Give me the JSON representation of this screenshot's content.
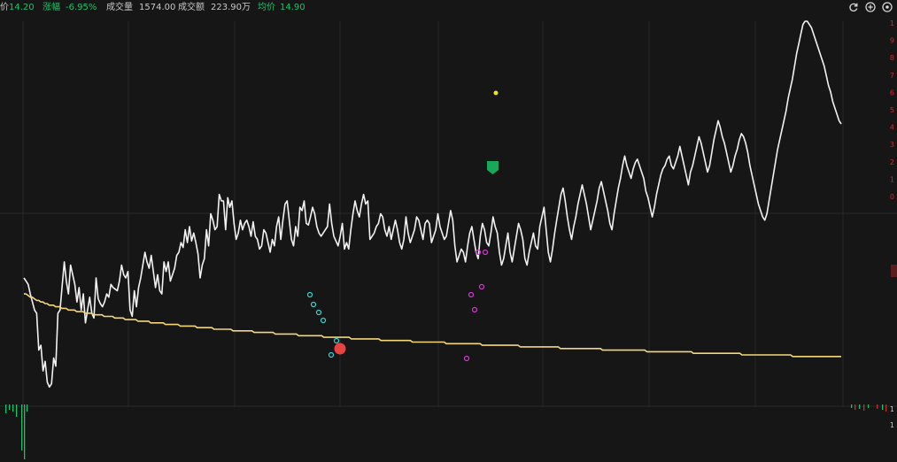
{
  "header": {
    "price_label": "价",
    "price_value": "14.20",
    "change_label": "涨幅",
    "change_value": "-6.95%",
    "volume_label": "成交量",
    "volume_value": "1574.00",
    "amount_label": "成交额",
    "amount_value": "223.90万",
    "avg_label": "均价",
    "avg_value": "14.90"
  },
  "toolbar": {
    "icons": [
      "refresh-icon",
      "zoom-in-icon",
      "settings-icon"
    ]
  },
  "colors": {
    "background": "#161616",
    "price_line": "#f2f2f2",
    "avg_line": "#f3d77a",
    "indicator_line": "#a450f0",
    "cyan_marker": "#39d4d4",
    "magenta_marker": "#d23ad2",
    "buy_badge": "#19a85a",
    "sell_badge": "#e84343",
    "down_text": "#1fc06a",
    "up_tick": "#c03030"
  },
  "right_axis": {
    "upper_ticks": [
      "1",
      "9",
      "8",
      "7",
      "6",
      "5",
      "4",
      "3",
      "2",
      "1",
      "0"
    ],
    "lower_ticks": [
      "1",
      "1"
    ]
  },
  "chart_data": {
    "type": "line",
    "series": [
      {
        "color": "#f2f2f2",
        "values": [
          80,
          78,
          76,
          70,
          65,
          60,
          58,
          35,
          38,
          22,
          28,
          15,
          12,
          14,
          30,
          25,
          58,
          60,
          75,
          90,
          78,
          70,
          88,
          82,
          76,
          65,
          74,
          60,
          70,
          52,
          60,
          68,
          58,
          55,
          80,
          67,
          64,
          62,
          65,
          70,
          68,
          76,
          74,
          73,
          72,
          78,
          88,
          82,
          80,
          84,
          60,
          56,
          72,
          62,
          74,
          80,
          88,
          96,
          90,
          86,
          94,
          84,
          74,
          82,
          72,
          70,
          90,
          84,
          90,
          78,
          82,
          86,
          94,
          96,
          102,
          99,
          110,
          102,
          112,
          103,
          108,
          102,
          95,
          80,
          88,
          92,
          110,
          100,
          120,
          116,
          110,
          112,
          132,
          128,
          128,
          110,
          130,
          124,
          128,
          114,
          104,
          108,
          116,
          110,
          114,
          116,
          112,
          106,
          115,
          106,
          104,
          98,
          100,
          110,
          108,
          102,
          96,
          104,
          100,
          112,
          118,
          104,
          116,
          126,
          128,
          116,
          104,
          100,
          112,
          106,
          124,
          122,
          128,
          114,
          113,
          118,
          124,
          120,
          112,
          108,
          106,
          108,
          110,
          112,
          126,
          114,
          106,
          103,
          100,
          106,
          114,
          98,
          102,
          98,
          110,
          120,
          128,
          122,
          118,
          126,
          132,
          126,
          128,
          104,
          106,
          108,
          112,
          114,
          120,
          118,
          110,
          106,
          112,
          104,
          110,
          116,
          110,
          102,
          98,
          104,
          118,
          108,
          102,
          106,
          110,
          118,
          116,
          110,
          104,
          114,
          116,
          114,
          102,
          106,
          110,
          120,
          112,
          108,
          104,
          106,
          114,
          122,
          116,
          100,
          90,
          94,
          98,
          96,
          90,
          100,
          108,
          112,
          104,
          96,
          92,
          106,
          114,
          110,
          102,
          100,
          108,
          118,
          112,
          108,
          96,
          88,
          92,
          100,
          108,
          96,
          90,
          98,
          106,
          114,
          110,
          104,
          92,
          88,
          96,
          102,
          108,
          100,
          98,
          112,
          118,
          124,
          110,
          96,
          90,
          98,
          108,
          116,
          124,
          132,
          136,
          128,
          118,
          110,
          104,
          112,
          118,
          126,
          132,
          138,
          132,
          126,
          118,
          110,
          116,
          122,
          128,
          136,
          140,
          134,
          128,
          122,
          114,
          110,
          120,
          128,
          136,
          142,
          150,
          156,
          150,
          146,
          142,
          148,
          152,
          154,
          150,
          146,
          142,
          134,
          130,
          124,
          118,
          124,
          132,
          138,
          144,
          148,
          150,
          154,
          156,
          150,
          148,
          152,
          156,
          162,
          156,
          150,
          144,
          138,
          146,
          150,
          156,
          162,
          168,
          164,
          158,
          152,
          146,
          150,
          158,
          166,
          172,
          178,
          174,
          168,
          164,
          158,
          152,
          146,
          150,
          156,
          160,
          166,
          170,
          168,
          164,
          158,
          150,
          144,
          138,
          132,
          126,
          122,
          118,
          116,
          120,
          128,
          136,
          144,
          152,
          160,
          166,
          172,
          178,
          184,
          192,
          198,
          204,
          212,
          220,
          226,
          232,
          238,
          240,
          240,
          238,
          236,
          232,
          228,
          224,
          220,
          216,
          212,
          206,
          200,
          196,
          190,
          186,
          182,
          178,
          176
        ]
      },
      {
        "color": "#f3d77a",
        "values": [
          70,
          70,
          69,
          68,
          68,
          67,
          66,
          66,
          65,
          65,
          64,
          64,
          63,
          63,
          63,
          62,
          62,
          62,
          61,
          61,
          61,
          60,
          60,
          60,
          60,
          59,
          59,
          59,
          59,
          58,
          58,
          58,
          58,
          57,
          57,
          57,
          57,
          57,
          56,
          56,
          56,
          56,
          56,
          55,
          55,
          55,
          55,
          55,
          54,
          54,
          54,
          54,
          54,
          54,
          53,
          53,
          53,
          53,
          53,
          53,
          52,
          52,
          52,
          52,
          52,
          52,
          52,
          51,
          51,
          51,
          51,
          51,
          51,
          51,
          50,
          50,
          50,
          50,
          50,
          50,
          50,
          50,
          49,
          49,
          49,
          49,
          49,
          49,
          49,
          49,
          48,
          48,
          48,
          48,
          48,
          48,
          48,
          48,
          48,
          47,
          47,
          47,
          47,
          47,
          47,
          47,
          47,
          47,
          47,
          46,
          46,
          46,
          46,
          46,
          46,
          46,
          46,
          46,
          46,
          45,
          45,
          45,
          45,
          45,
          45,
          45,
          45,
          45,
          45,
          45,
          44,
          44,
          44,
          44,
          44,
          44,
          44,
          44,
          44,
          44,
          44,
          44,
          43,
          43,
          43,
          43,
          43,
          43,
          43,
          43,
          43,
          43,
          43,
          43,
          43,
          42,
          42,
          42,
          42,
          42,
          42,
          42,
          42,
          42,
          42,
          42,
          42,
          42,
          42,
          41,
          41,
          41,
          41,
          41,
          41,
          41,
          41,
          41,
          41,
          41,
          41,
          41,
          41,
          41,
          40,
          40,
          40,
          40,
          40,
          40,
          40,
          40,
          40,
          40,
          40,
          40,
          40,
          40,
          40,
          40,
          39,
          39,
          39,
          39,
          39,
          39,
          39,
          39,
          39,
          39,
          39,
          39,
          39,
          39,
          39,
          39,
          39,
          38,
          38,
          38,
          38,
          38,
          38,
          38,
          38,
          38,
          38,
          38,
          38,
          38,
          38,
          38,
          38,
          38,
          38,
          37,
          37,
          37,
          37,
          37,
          37,
          37,
          37,
          37,
          37,
          37,
          37,
          37,
          37,
          37,
          37,
          37,
          37,
          37,
          36,
          36,
          36,
          36,
          36,
          36,
          36,
          36,
          36,
          36,
          36,
          36,
          36,
          36,
          36,
          36,
          36,
          36,
          36,
          36,
          35,
          35,
          35,
          35,
          35,
          35,
          35,
          35,
          35,
          35,
          35,
          35,
          35,
          35,
          35,
          35,
          35,
          35,
          35,
          35,
          35,
          34,
          34,
          34,
          34,
          34,
          34,
          34,
          34,
          34,
          34,
          34,
          34,
          34,
          34,
          34,
          34,
          34,
          34,
          34,
          34,
          34,
          34,
          33,
          33,
          33,
          33,
          33,
          33,
          33,
          33,
          33,
          33,
          33,
          33,
          33,
          33,
          33,
          33,
          33,
          33,
          33,
          33,
          33,
          33,
          33,
          32,
          32,
          32,
          32,
          32,
          32,
          32,
          32,
          32,
          32,
          32,
          32,
          32,
          32,
          32,
          32,
          32,
          32,
          32,
          32,
          32,
          32,
          32,
          32,
          31,
          31,
          31,
          31,
          31,
          31,
          31,
          31,
          31,
          31,
          31,
          31,
          31,
          31,
          31,
          31,
          31,
          31,
          31,
          31,
          31,
          31,
          31,
          31
        ]
      }
    ]
  }
}
